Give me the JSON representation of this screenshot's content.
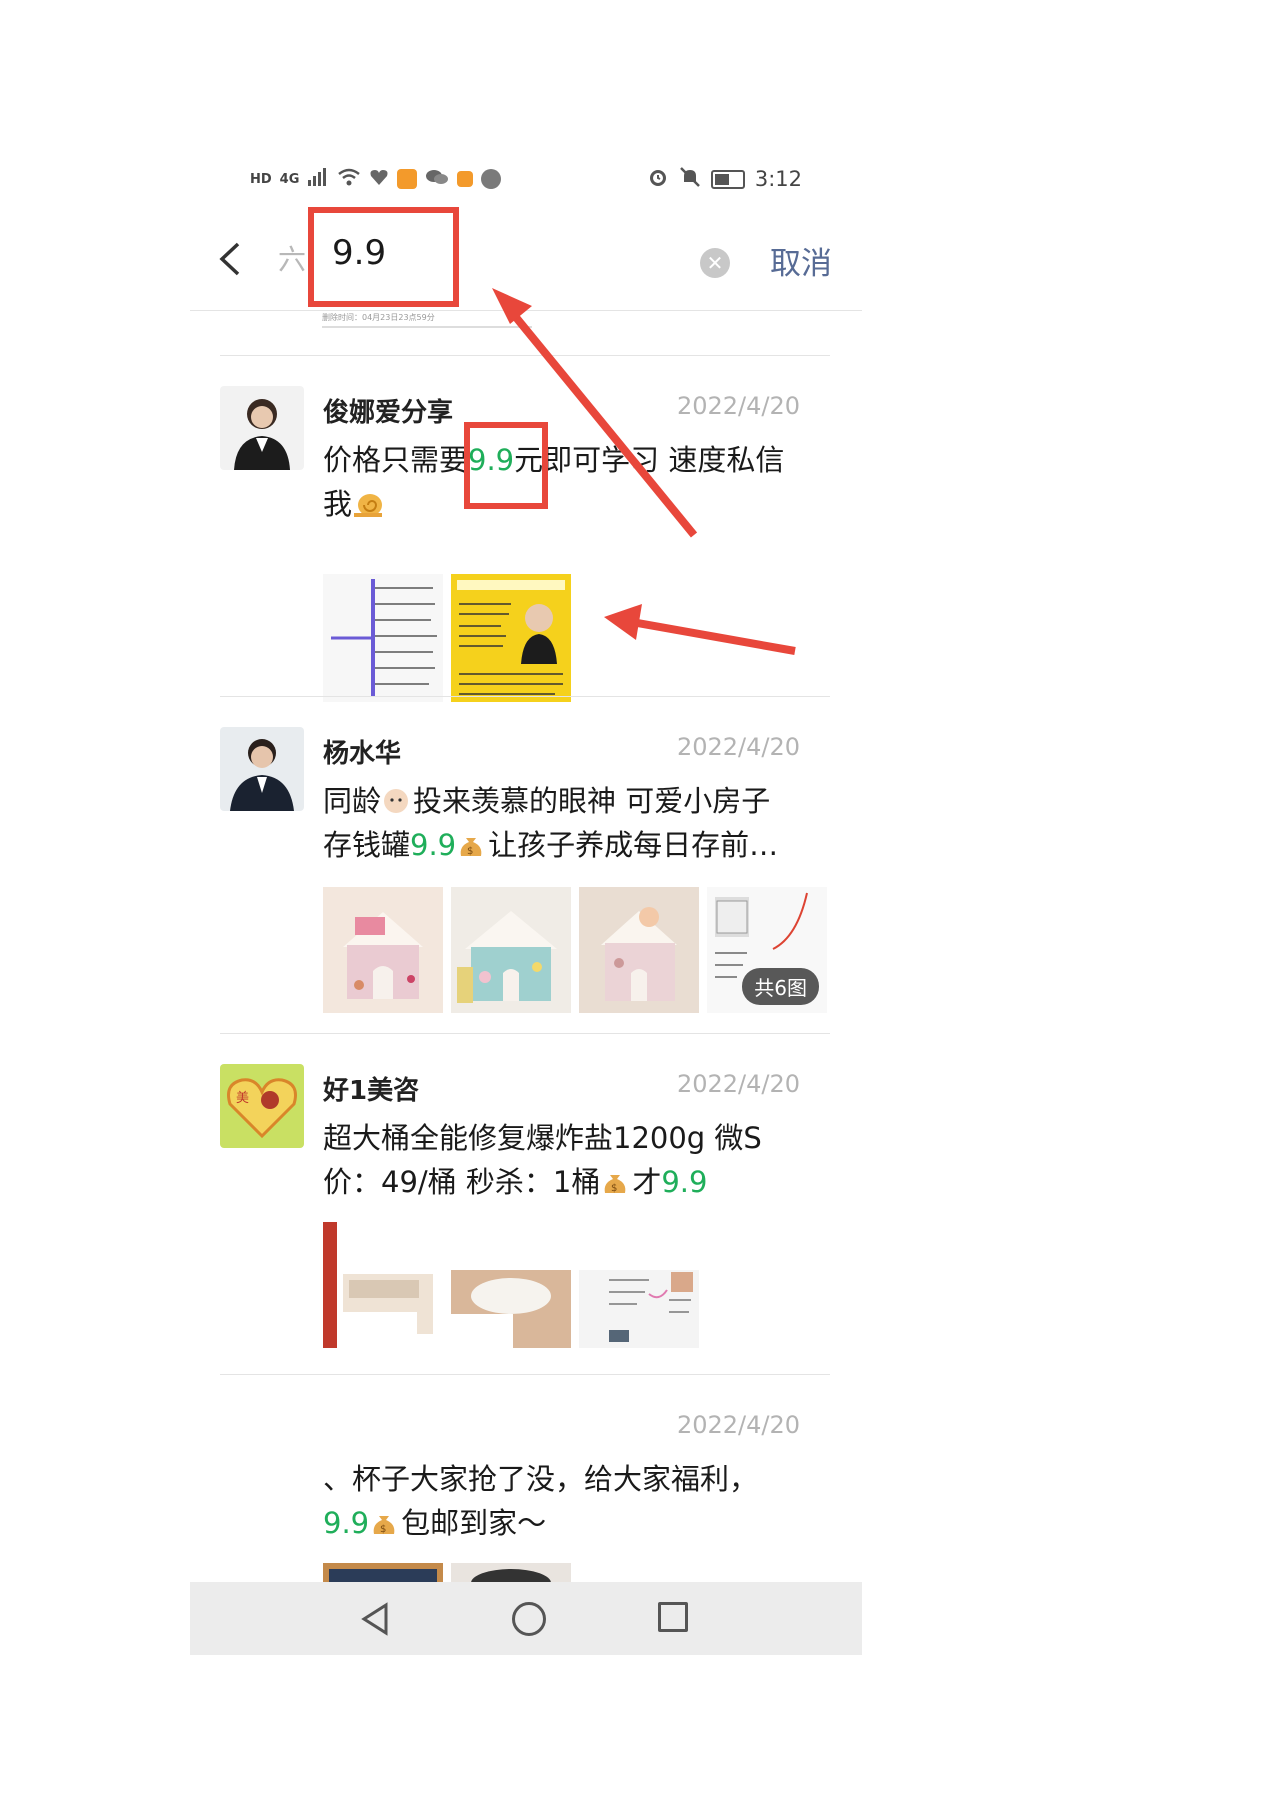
{
  "status_bar": {
    "network": "4G",
    "time": "3:12",
    "hd_label": "HD"
  },
  "search": {
    "prefix": "六",
    "query": "9.9",
    "cancel_label": "取消"
  },
  "hidden_strip_text": "删除时间：04月23日23点59分",
  "posts": [
    {
      "author": "俊娜爱分享",
      "date": "2022/4/20",
      "text_before": "价格只需要",
      "highlight": "9.9",
      "text_after": "元即可学习 速度私信我"
    },
    {
      "author": "杨水华",
      "date": "2022/4/20",
      "text_before": "同龄",
      "text_mid": "投来羡慕的眼神 可爱小房子存钱罐",
      "highlight": "9.9",
      "text_after": "让孩子养成每日存前…",
      "more_badge": "共6图"
    },
    {
      "author": "好1美咨",
      "date": "2022/4/20",
      "text_before": "超大桶全能修复爆炸盐1200g 微S价：49/桶 秒杀：1桶",
      "text_mid": "才",
      "highlight": "9.9"
    },
    {
      "author": "",
      "date": "2022/4/20",
      "text_before": "、杯子大家抢了没，给大家福利，",
      "highlight": "9.9",
      "text_after": "包邮到家～"
    }
  ],
  "colors": {
    "highlight": "#1fae5a",
    "link": "#576b95",
    "annotation": "#e8473b"
  }
}
